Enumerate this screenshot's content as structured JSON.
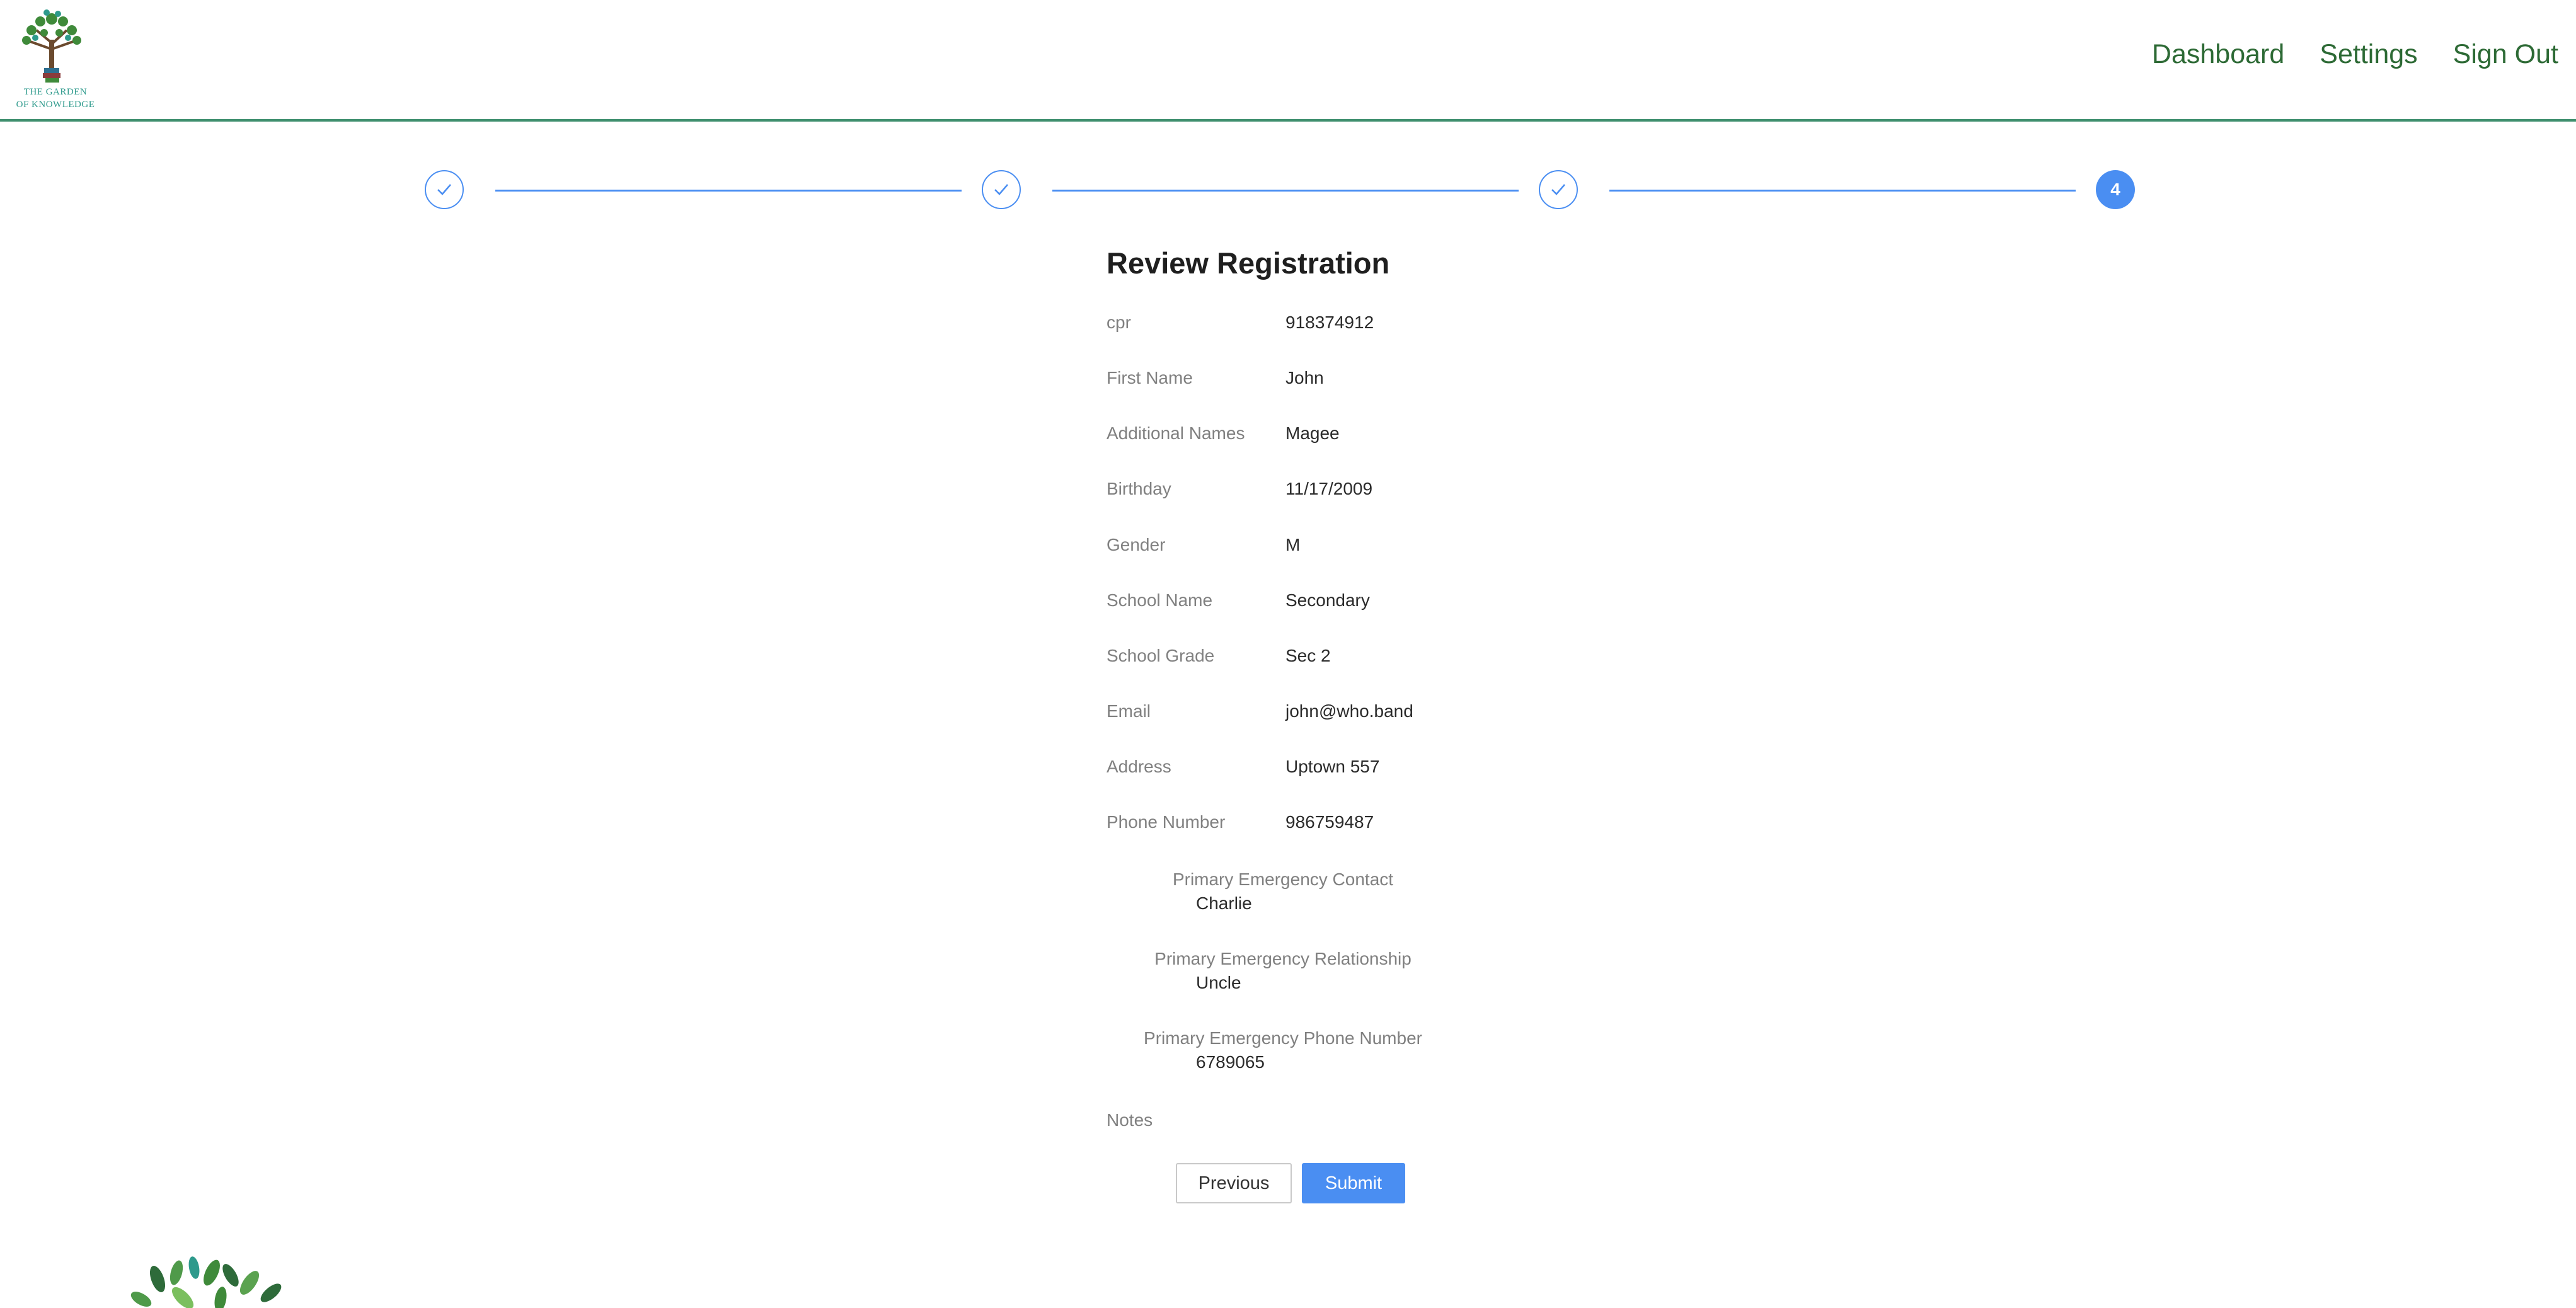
{
  "header": {
    "logo_line1": "The Garden",
    "logo_line2": "of Knowledge",
    "nav": [
      "Dashboard",
      "Settings",
      "Sign Out"
    ]
  },
  "stepper": {
    "current_step": "4",
    "completed_steps": 3
  },
  "review": {
    "title": "Review Registration",
    "fields": [
      {
        "label": "cpr",
        "value": "918374912"
      },
      {
        "label": "First Name",
        "value": "John"
      },
      {
        "label": "Additional Names",
        "value": "Magee"
      },
      {
        "label": "Birthday",
        "value": "11/17/2009"
      },
      {
        "label": "Gender",
        "value": "M"
      },
      {
        "label": "School Name",
        "value": "Secondary"
      },
      {
        "label": "School Grade",
        "value": "Sec 2"
      },
      {
        "label": "Email",
        "value": "john@who.band"
      },
      {
        "label": "Address",
        "value": "Uptown 557"
      },
      {
        "label": "Phone Number",
        "value": "986759487"
      }
    ],
    "emergency": [
      {
        "label": "Primary Emergency Contact",
        "value": "Charlie"
      },
      {
        "label": "Primary Emergency Relationship",
        "value": "Uncle"
      },
      {
        "label": "Primary Emergency Phone Number",
        "value": "6789065"
      }
    ],
    "notes_label": "Notes"
  },
  "actions": {
    "previous": "Previous",
    "submit": "Submit"
  },
  "colors": {
    "accent": "#4a8ef2",
    "brand_green": "#2d6a35",
    "header_border": "#3f8f6e"
  }
}
